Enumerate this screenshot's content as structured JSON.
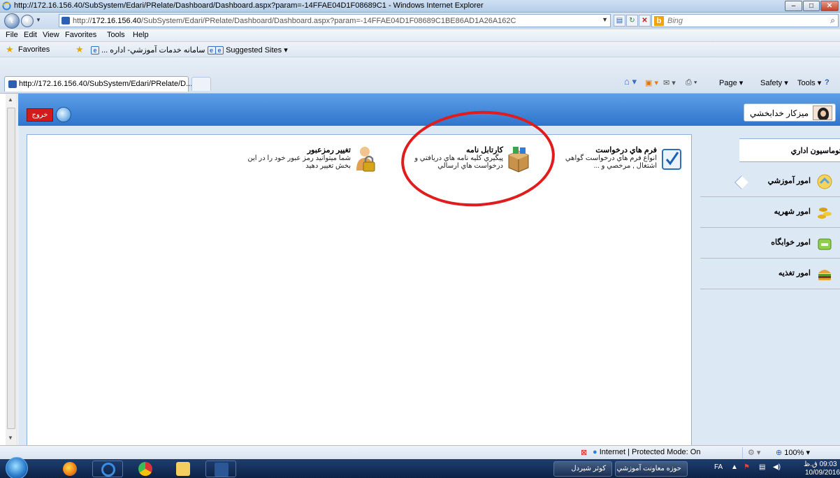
{
  "window": {
    "title": "http://172.16.156.40/SubSystem/Edari/PRelate/Dashboard/Dashboard.aspx?param=-14FFAE04D1F08689C1 - Windows Internet Explorer"
  },
  "address_bar": {
    "url_prefix": "http://",
    "url_host": "172.16.156.40",
    "url_rest": "/SubSystem/Edari/PRelate/Dashboard/Dashboard.aspx?param=-14FFAE04D1F08689C1BE86AD1A26A162C",
    "search_placeholder": "Bing"
  },
  "menu": [
    "File",
    "Edit",
    "View",
    "Favorites",
    "Tools",
    "Help"
  ],
  "favorites_bar": {
    "label": "Favorites",
    "items": [
      "سامانه خدمات آموزشي- اداره ...",
      "Suggested Sites ▾"
    ]
  },
  "tab": {
    "title": "http://172.16.156.40/SubSystem/Edari/PRelate/D..."
  },
  "command_bar": [
    "Page ▾",
    "Safety ▾",
    "Tools ▾"
  ],
  "app_header": {
    "logout_label": "خروج",
    "user_name": "ميزكار خدابخشي"
  },
  "tiles": [
    {
      "title": "فرم هاي درخواست",
      "description": "انواع فرم هاي درخواست گواهي اشتغال , مرخصي و ..."
    },
    {
      "title": "كارتابل نامه",
      "description": "پيگيري كليه نامه هاي دريافتي و درخواست هاي ارسالي"
    },
    {
      "title": "تغيير رمزعبور",
      "description": "شما ميتوانيد رمز عبور خود را در اين بخش تغيير دهيد"
    }
  ],
  "sidebar": [
    {
      "label": "اتوماسيون اداري",
      "icon": "office-automation-icon",
      "active": true
    },
    {
      "label": "امور آموزشي",
      "icon": "education-icon"
    },
    {
      "label": "امور شهريه",
      "icon": "tuition-coins-icon"
    },
    {
      "label": "امور خوابگاه",
      "icon": "dormitory-icon"
    },
    {
      "label": "امور تغذيه",
      "icon": "food-burger-icon"
    }
  ],
  "status_bar": {
    "zone": "Internet | Protected Mode: On",
    "zoom": "100%"
  },
  "taskbar": {
    "buttons": [
      "حوزه معاونت آموزشي",
      "كوثر شيردل"
    ],
    "lang": "FA",
    "time": "09:03 ق.ظ",
    "date": "10/09/2016"
  },
  "colors": {
    "app_header": "#3f86d8",
    "logout": "#d21c1c",
    "highlight_ellipse": "#e01c1c",
    "sidebar_bg": "#dde8f5"
  }
}
